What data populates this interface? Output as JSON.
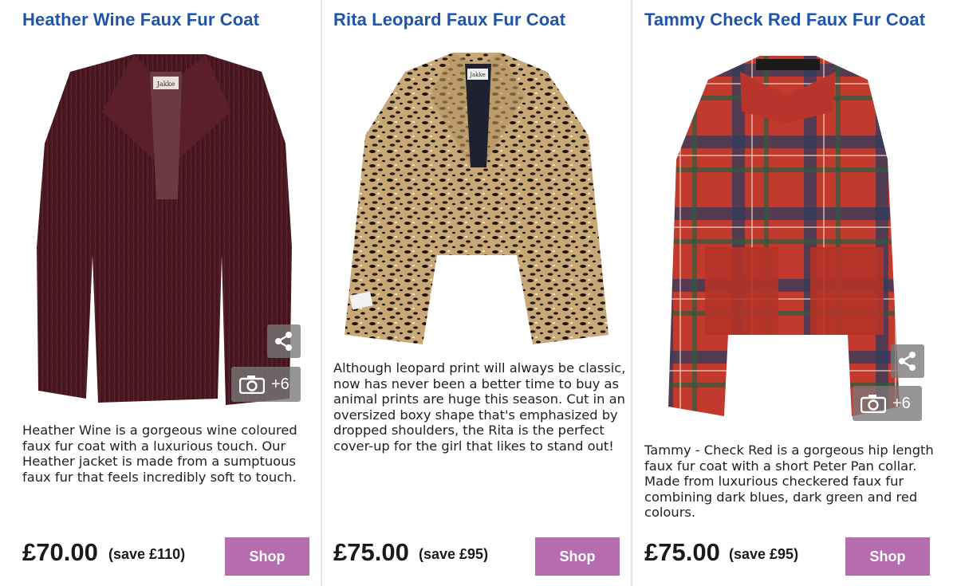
{
  "products": [
    {
      "title": "Heather Wine Faux Fur Coat",
      "image_alt": "wine faux fur coat",
      "photo_count": "+6",
      "description_lines": [
        "Heather Wine is a gorgeous wine coloured",
        "faux fur coat with a luxurious touch. Our",
        "Heather jacket is made from a sumptuous",
        "faux fur that feels incredibly soft to touch."
      ],
      "price": "£70.00",
      "save": "(save £110)",
      "shop_label": "Shop",
      "coat_color": "#4a1820"
    },
    {
      "title": "Rita Leopard Faux Fur Coat",
      "image_alt": "leopard print faux fur coat",
      "photo_count": "",
      "description_lines": [
        "Although leopard print will always be classic,",
        "now has never been a better time to buy as",
        "animal prints are huge this season. Cut in an",
        "oversized boxy shape that's emphasized by",
        "dropped shoulders, the Rita is the perfect",
        "cover-up for the girl that likes to stand out!"
      ],
      "price": "£75.00",
      "save": "(save £95)",
      "shop_label": "Shop",
      "coat_color": "#b89564"
    },
    {
      "title": "Tammy Check Red Faux Fur Coat",
      "image_alt": "red check faux fur coat",
      "photo_count": "+6",
      "description_lines": [
        "Tammy - Check Red is a gorgeous hip length",
        "faux fur coat with a short Peter Pan collar.",
        "Made from luxurious checkered faux fur",
        "combining dark blues, dark green and red",
        "colours."
      ],
      "price": "£75.00",
      "save": "(save £95)",
      "shop_label": "Shop",
      "coat_color": "#c23a2e"
    }
  ],
  "colors": {
    "title": "#1f55a8",
    "shop_button": "#b66db0",
    "overlay_button": "#787878",
    "divider": "#e4e4e4"
  },
  "icons": {
    "share": "share-icon",
    "camera": "camera-icon"
  }
}
